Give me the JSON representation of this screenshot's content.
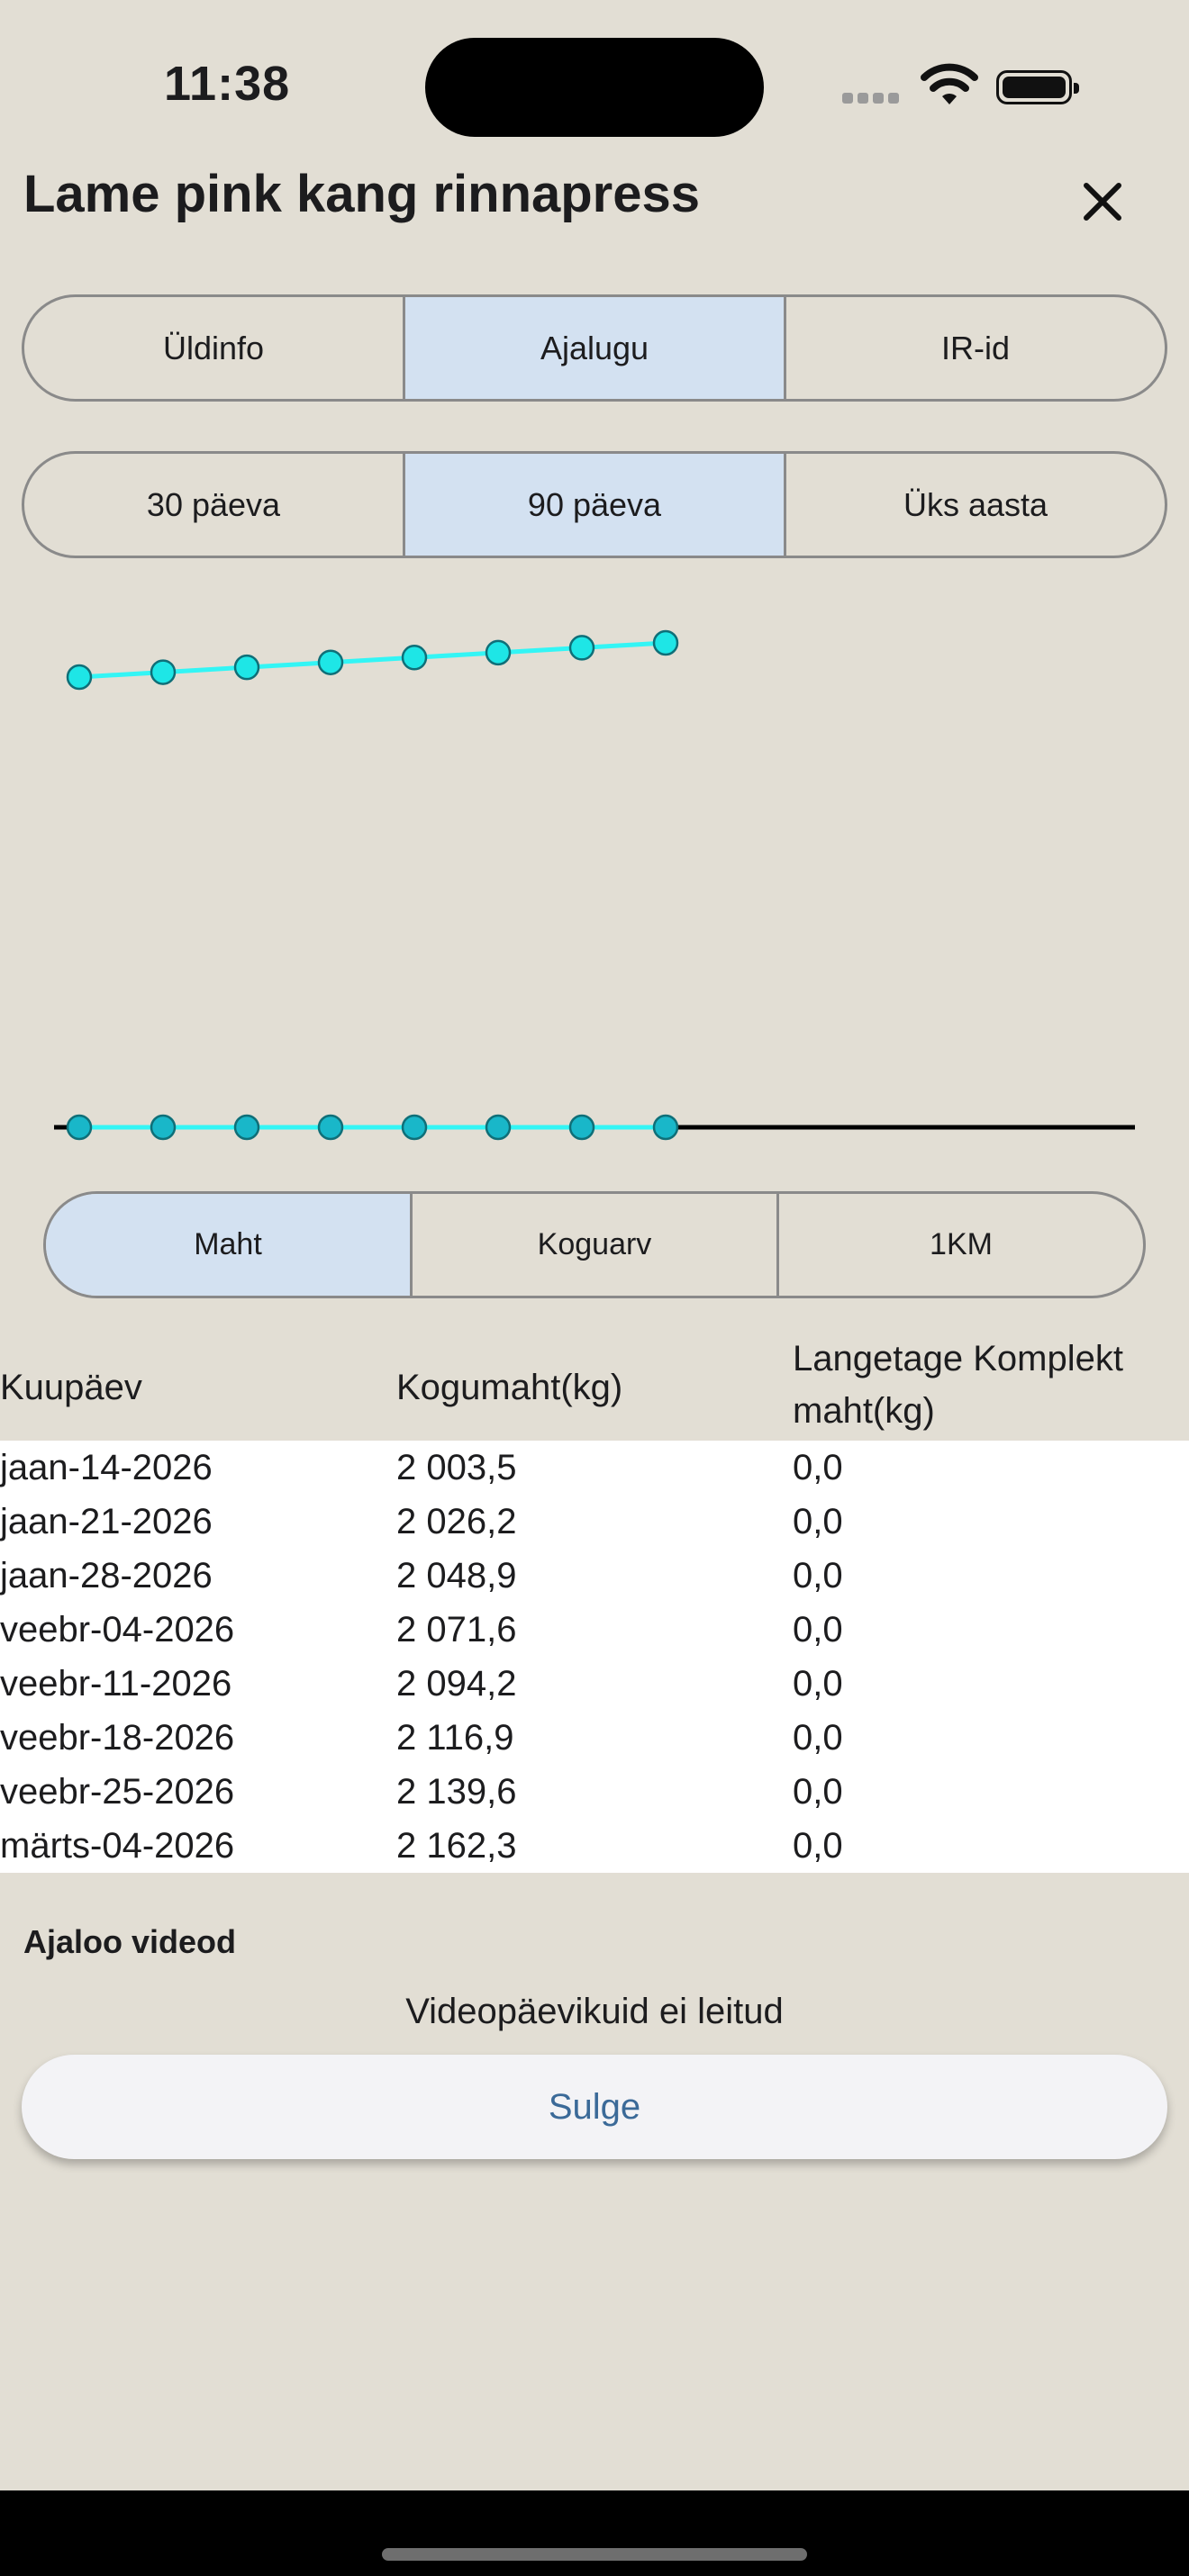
{
  "status_bar": {
    "time": "11:38"
  },
  "header": {
    "title": "Lame pink kang rinnapress",
    "close_icon": "close-icon"
  },
  "tabs": [
    {
      "label": "Üldinfo",
      "selected": false
    },
    {
      "label": "Ajalugu",
      "selected": true
    },
    {
      "label": "IR-id",
      "selected": false
    }
  ],
  "ranges": [
    {
      "label": "30 päeva",
      "selected": false
    },
    {
      "label": "90 päeva",
      "selected": true
    },
    {
      "label": "Üks aasta",
      "selected": false
    }
  ],
  "metrics": [
    {
      "label": "Maht",
      "selected": true
    },
    {
      "label": "Koguarv",
      "selected": false
    },
    {
      "label": "1KM",
      "selected": false
    }
  ],
  "chart_data": {
    "type": "line",
    "x": [
      "jaan-14-2026",
      "jaan-21-2026",
      "jaan-28-2026",
      "veebr-04-2026",
      "veebr-11-2026",
      "veebr-18-2026",
      "veebr-25-2026",
      "märts-04-2026"
    ],
    "series": [
      {
        "values": [
          2003.5,
          2026.2,
          2048.9,
          2071.6,
          2094.2,
          2116.9,
          2139.6,
          2162.3
        ],
        "color": "#21f0f0"
      },
      {
        "values": [
          0.0,
          0.0,
          0.0,
          0.0,
          0.0,
          0.0,
          0.0,
          0.0
        ],
        "color": "#1ab8c8"
      }
    ],
    "grid": false,
    "colors": {
      "line": "#33f5f5",
      "marker_fill": "#1ee6e6",
      "marker_stroke": "#0f6f78",
      "zero_marker_fill": "#19b7c9",
      "baseline": "#000000"
    }
  },
  "table": {
    "headers": [
      "Kuupäev",
      "Kogumaht(kg)",
      "Langetage Komplekt maht(kg)"
    ],
    "rows": [
      [
        "jaan-14-2026",
        "2 003,5",
        "0,0"
      ],
      [
        "jaan-21-2026",
        "2 026,2",
        "0,0"
      ],
      [
        "jaan-28-2026",
        "2 048,9",
        "0,0"
      ],
      [
        "veebr-04-2026",
        "2 071,6",
        "0,0"
      ],
      [
        "veebr-11-2026",
        "2 094,2",
        "0,0"
      ],
      [
        "veebr-18-2026",
        "2 116,9",
        "0,0"
      ],
      [
        "veebr-25-2026",
        "2 139,6",
        "0,0"
      ],
      [
        "märts-04-2026",
        "2 162,3",
        "0,0"
      ]
    ]
  },
  "videos": {
    "title": "Ajaloo videod",
    "empty_text": "Videopäevikuid ei leitud"
  },
  "footer": {
    "close_label": "Sulge"
  },
  "colors": {
    "background": "#e2ded4",
    "segment_selected": "#d3e1f1",
    "accent_text": "#3b6a98"
  }
}
